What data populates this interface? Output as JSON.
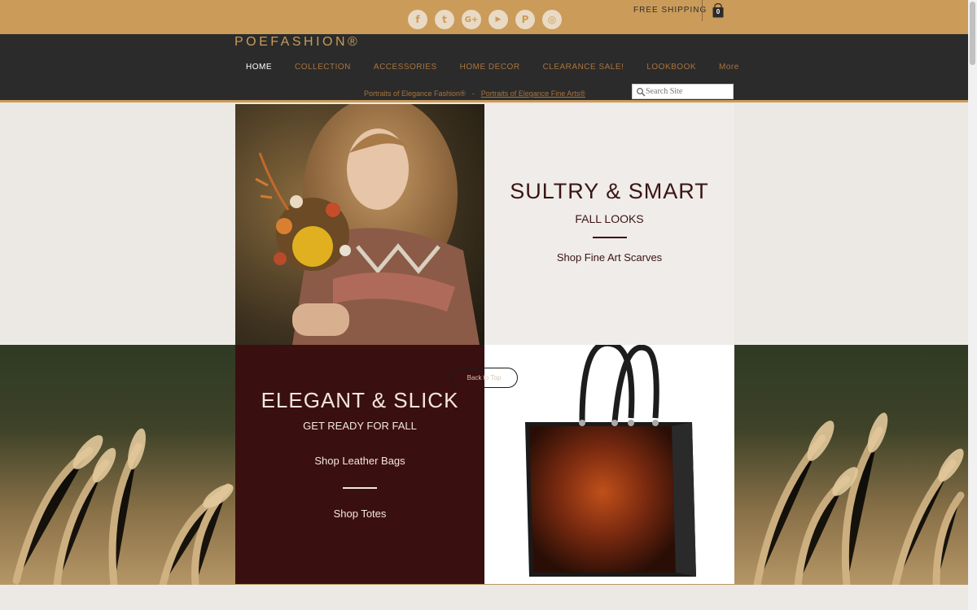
{
  "topbar": {
    "social_icons": [
      {
        "name": "facebook-icon",
        "glyph": "f"
      },
      {
        "name": "twitter-icon",
        "glyph": "t"
      },
      {
        "name": "google-plus-icon",
        "glyph": "G+"
      },
      {
        "name": "youtube-icon",
        "glyph": "▶"
      },
      {
        "name": "pinterest-icon",
        "glyph": "P"
      },
      {
        "name": "instagram-icon",
        "glyph": "◎"
      }
    ],
    "free_shipping": "FREE SHIPPING",
    "cart_count": "0"
  },
  "header": {
    "logo": "POEFASHION®",
    "nav": [
      "HOME",
      "COLLECTION",
      "ACCESSORIES",
      "HOME DECOR",
      "CLEARANCE SALE!",
      "LOOKBOOK",
      "More"
    ],
    "active_nav": "HOME",
    "subnav": {
      "link1": "Portraits of Elegance Fashion®",
      "separator": "-",
      "link2": "Portraits of Elegance Fine Arts®"
    },
    "search_placeholder": "Search Site"
  },
  "hero1": {
    "title": "SULTRY & SMART",
    "subtitle": "FALL LOOKS",
    "link": "Shop Fine Art Scarves"
  },
  "hero2": {
    "title": "ELEGANT & SLICK",
    "subtitle": "GET READY FOR FALL",
    "link1": "Shop Leather Bags",
    "link2": "Shop Totes"
  },
  "back_to_top": "Back to Top",
  "colors": {
    "topbar": "#cb9b59",
    "header": "#2b2b2b",
    "accent": "#cb9b59",
    "burgundy": "#3a0f0f",
    "text_dark": "#3a1414"
  }
}
